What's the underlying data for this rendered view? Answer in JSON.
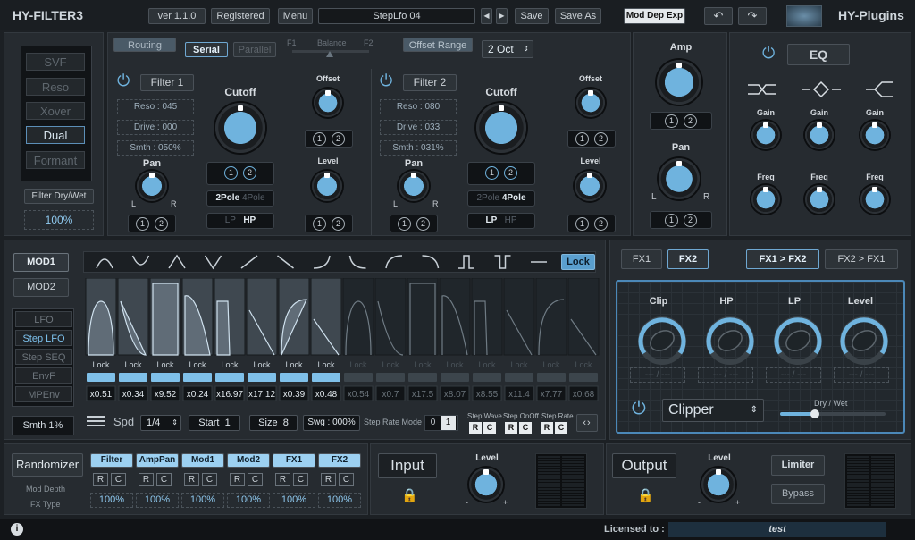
{
  "header": {
    "brand": "HY-FILTER3",
    "version": "ver 1.1.0",
    "registered": "Registered",
    "menu": "Menu",
    "preset": "StepLfo 04",
    "save": "Save",
    "save_as": "Save As",
    "mod_dep_exp": "Mod Dep Exp",
    "company": "HY-Plugins"
  },
  "left": {
    "types": [
      "SVF",
      "Reso",
      "Xover",
      "Dual",
      "Formant"
    ],
    "selected_type": "Dual",
    "dry_wet_label": "Filter Dry/Wet",
    "dry_wet_value": "100%"
  },
  "routing": {
    "routing": "Routing",
    "serial": "Serial",
    "parallel": "Parallel",
    "f1": "F1",
    "balance": "Balance",
    "f2": "F2",
    "offset_range": "Offset Range",
    "offset_range_value": "2 Oct"
  },
  "filter1": {
    "name": "Filter 1",
    "reso": "Reso : 045",
    "drive": "Drive : 000",
    "smth": "Smth : 050%",
    "cutoff": "Cutoff",
    "offset": "Offset",
    "level": "Level",
    "pan": "Pan",
    "pole2": "2Pole",
    "pole4": "4Pole",
    "lp": "LP",
    "hp": "HP",
    "l": "L",
    "r": "R",
    "one": "1",
    "two": "2"
  },
  "filter2": {
    "name": "Filter 2",
    "reso": "Reso : 080",
    "drive": "Drive : 033",
    "smth": "Smth : 031%",
    "cutoff": "Cutoff",
    "offset": "Offset",
    "level": "Level",
    "pan": "Pan",
    "pole2": "2Pole",
    "pole4": "4Pole",
    "lp": "LP",
    "hp": "HP",
    "l": "L",
    "r": "R",
    "one": "1",
    "two": "2"
  },
  "amp": {
    "amp": "Amp",
    "pan": "Pan",
    "l": "L",
    "r": "R",
    "one": "1",
    "two": "2"
  },
  "eq": {
    "title": "EQ",
    "gain": "Gain",
    "freq": "Freq",
    "minus": "-",
    "plus": "+"
  },
  "mod": {
    "mod1": "MOD1",
    "mod2": "MOD2",
    "sources": [
      "LFO",
      "Step LFO",
      "Step SEQ",
      "EnvF",
      "MPEnv"
    ],
    "selected_source": "Step LFO",
    "smth": "Smth 1%",
    "lock": "Lock",
    "step_lock": "Lock",
    "multipliers": [
      "x0.51",
      "x0.34",
      "x9.52",
      "x0.24",
      "x16.97",
      "x17.12",
      "x0.39",
      "x0.48",
      "x0.54",
      "x0.7",
      "x17.5",
      "x8.07",
      "x8.55",
      "x11.4",
      "x7.77",
      "x0.68"
    ],
    "spd": "Spd",
    "spd_value": "1/4",
    "start": "Start",
    "start_value": "1",
    "size": "Size",
    "size_value": "8",
    "swg": "Swg : 000%",
    "step_rate_mode": "Step Rate Mode",
    "srm_0": "0",
    "srm_1": "1",
    "step_wave": "Step Wave",
    "step_onoff": "Step OnOff",
    "step_rate": "Step Rate",
    "r": "R",
    "c": "C"
  },
  "fx": {
    "fx1": "FX1",
    "fx2": "FX2",
    "fx1_fx2": "FX1 > FX2",
    "fx2_fx1": "FX2 > FX1",
    "clip": "Clip",
    "hp": "HP",
    "lp": "LP",
    "level": "Level",
    "type": "Clipper",
    "dry_wet": "Dry / Wet",
    "dashes": "--- / ---"
  },
  "bottom": {
    "randomizer": "Randomizer",
    "mod_depth": "Mod Depth",
    "fx_type": "FX Type",
    "cols": [
      "Filter",
      "AmpPan",
      "Mod1",
      "Mod2",
      "FX1",
      "FX2"
    ],
    "vals": [
      "100%",
      "100%",
      "100%",
      "100%",
      "100%",
      "100%"
    ],
    "r": "R",
    "c": "C",
    "input": "Input",
    "output": "Output",
    "level": "Level",
    "limiter": "Limiter",
    "bypass": "Bypass",
    "licensed": "Licensed to :",
    "user": "test",
    "minus": "-",
    "plus": "+"
  },
  "colors": {
    "accent": "#5a9fce",
    "knob": "#6fb3de",
    "bg": "#1c2024"
  }
}
